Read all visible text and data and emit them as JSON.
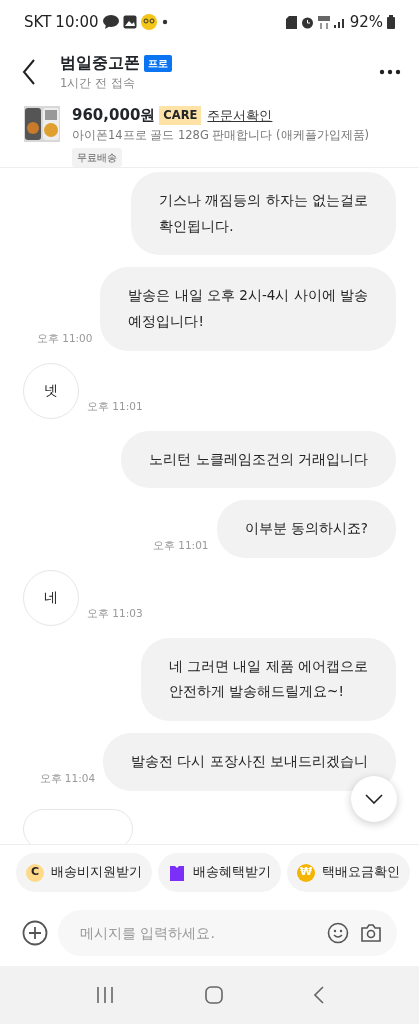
{
  "status_bar": {
    "carrier": "SKT",
    "time": "10:00",
    "battery": "92%"
  },
  "header": {
    "title": "범일중고폰",
    "badge": "프로",
    "subtitle": "1시간 전 접속"
  },
  "product": {
    "price": "960,000원",
    "care_badge": "CARE",
    "order_link": "주문서확인",
    "description": "아이폰14프로 골드 128G 판매합니다 (애케플가입제품)",
    "tag": "무료배송"
  },
  "messages": [
    {
      "kind": "sent",
      "lines": [
        "기스나 깨짐등의 하자는 없는걸로",
        "확인됩니다."
      ]
    },
    {
      "kind": "sent",
      "lines": [
        "발송은 내일 오후 2시-4시 사이에 발송",
        "예정입니다!"
      ],
      "time": "오후 11:00"
    },
    {
      "kind": "received",
      "lines": [
        "넷"
      ],
      "time": "오후 11:01"
    },
    {
      "kind": "sent",
      "lines": [
        "노리턴 노클레임조건의 거래입니다"
      ]
    },
    {
      "kind": "sent",
      "lines": [
        "이부분 동의하시죠?"
      ],
      "time": "오후 11:01"
    },
    {
      "kind": "received",
      "lines": [
        "네"
      ],
      "time": "오후 11:03"
    },
    {
      "kind": "sent",
      "lines": [
        "네 그러면 내일 제품 에어캡으로",
        "안전하게 발송해드릴게요~!"
      ]
    },
    {
      "kind": "sent",
      "lines": [
        "발송전 다시 포장사진 보내드리겠습니"
      ],
      "time": "오후 11:04"
    }
  ],
  "quick_actions": [
    {
      "label": "배송비지원받기",
      "kind": "coin",
      "glyph": "C"
    },
    {
      "label": "배송혜택받기",
      "kind": "bag"
    },
    {
      "label": "택배요금확인",
      "kind": "won",
      "glyph": "₩"
    }
  ],
  "composer": {
    "placeholder": "메시지를 입력하세요."
  }
}
